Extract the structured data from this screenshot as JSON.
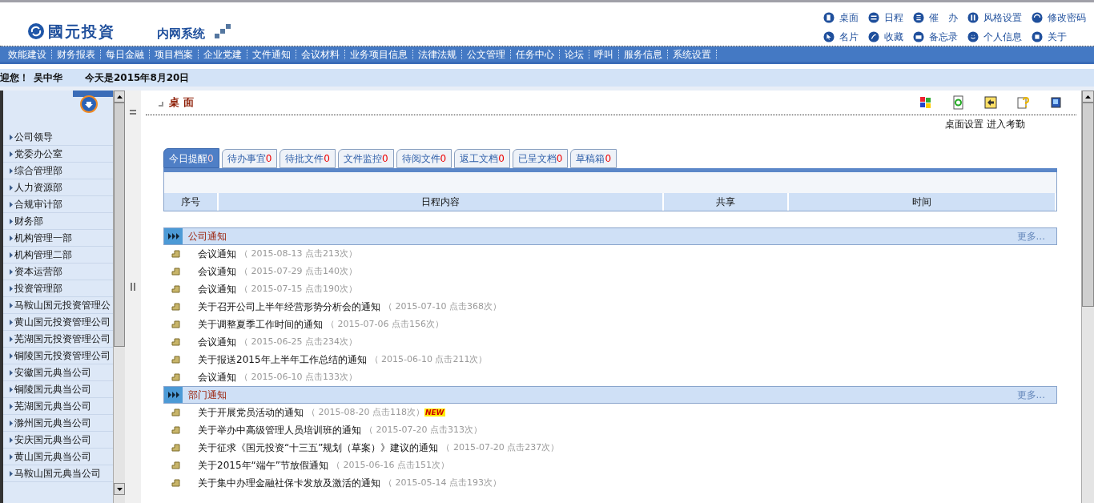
{
  "header": {
    "logo_text": "國元投資",
    "system_name": "内网系统",
    "links": [
      {
        "label": "桌面",
        "kind": "desk"
      },
      {
        "label": "日程",
        "kind": "schedule"
      },
      {
        "label": "催　办",
        "kind": "urge"
      },
      {
        "label": "风格设置",
        "kind": "style"
      },
      {
        "label": "修改密码",
        "kind": "password"
      },
      {
        "label": "名片",
        "kind": "card"
      },
      {
        "label": "收藏",
        "kind": "favorite"
      },
      {
        "label": "备忘录",
        "kind": "memo"
      },
      {
        "label": "个人信息",
        "kind": "person"
      },
      {
        "label": "关于",
        "kind": "about"
      }
    ]
  },
  "nav": [
    "效能建设",
    "财务报表",
    "每日金融",
    "项目档案",
    "企业党建",
    "文件通知",
    "会议材料",
    "业务项目信息",
    "法律法规",
    "公文管理",
    "任务中心",
    "论坛",
    "呼叫",
    "服务信息",
    "系统设置"
  ],
  "welcome": {
    "greeting": "迎您！",
    "user": "吴中华",
    "date": "今天是2015年8月20日"
  },
  "sidebar": {
    "items": [
      "公司领导",
      "党委办公室",
      "综合管理部",
      "人力资源部",
      "合规审计部",
      "财务部",
      "机构管理一部",
      "机构管理二部",
      "资本运营部",
      "投资管理部",
      "马鞍山国元投资管理公",
      "黄山国元投资管理公司",
      "芜湖国元投资管理公司",
      "铜陵国元投资管理公司",
      "安徽国元典当公司",
      "铜陵国元典当公司",
      "芜湖国元典当公司",
      "滁州国元典当公司",
      "安庆国元典当公司",
      "黄山国元典当公司",
      "马鞍山国元典当公司"
    ]
  },
  "page": {
    "title": "桌 面",
    "new_label": "NEW",
    "actions": [
      "桌面设置",
      "进入考勤"
    ],
    "tabs": [
      {
        "label": "今日提醒",
        "count": "0",
        "selected": true
      },
      {
        "label": "待办事宜",
        "count": "0",
        "selected": false
      },
      {
        "label": "待批文件",
        "count": "0",
        "selected": false
      },
      {
        "label": "文件监控",
        "count": "0",
        "selected": false
      },
      {
        "label": "待阅文件",
        "count": "0",
        "selected": false
      },
      {
        "label": "返工文档",
        "count": "0",
        "selected": false
      },
      {
        "label": "已呈文档",
        "count": "0",
        "selected": false
      },
      {
        "label": "草稿箱",
        "count": "0",
        "selected": false
      }
    ],
    "table": {
      "columns": [
        "序号",
        "日程内容",
        "共享",
        "时间"
      ]
    },
    "sections": [
      {
        "title": "公司通知",
        "more": "更多...",
        "items": [
          {
            "title": "会议通知",
            "meta": "（ 2015-08-13  点击213次）",
            "new": false
          },
          {
            "title": "会议通知",
            "meta": "（ 2015-07-29  点击140次）",
            "new": false
          },
          {
            "title": "会议通知",
            "meta": "（ 2015-07-15  点击190次）",
            "new": false
          },
          {
            "title": "关于召开公司上半年经营形势分析会的通知",
            "meta": "（ 2015-07-10  点击368次）",
            "new": false
          },
          {
            "title": "关于调整夏季工作时间的通知",
            "meta": "（ 2015-07-06  点击156次）",
            "new": false
          },
          {
            "title": "会议通知",
            "meta": "（ 2015-06-25  点击234次）",
            "new": false
          },
          {
            "title": "关于报送2015年上半年工作总结的通知",
            "meta": "（ 2015-06-10  点击211次）",
            "new": false
          },
          {
            "title": "会议通知",
            "meta": "（ 2015-06-10  点击133次）",
            "new": false
          }
        ]
      },
      {
        "title": "部门通知",
        "more": "更多...",
        "items": [
          {
            "title": "关于开展党员活动的通知",
            "meta": "（ 2015-08-20  点击118次）",
            "new": true
          },
          {
            "title": "关于举办中高级管理人员培训班的通知",
            "meta": "（ 2015-07-20  点击313次）",
            "new": false
          },
          {
            "title": "关于征求《国元投资“十三五”规划（草案）》建议的通知",
            "meta": "（ 2015-07-20  点击237次）",
            "new": false
          },
          {
            "title": "关于2015年“端午”节放假通知",
            "meta": "（ 2015-06-16  点击151次）",
            "new": false
          },
          {
            "title": "关于集中办理金融社保卡发放及激活的通知",
            "meta": "（ 2015-05-14  点击193次）",
            "new": false
          }
        ]
      }
    ]
  }
}
